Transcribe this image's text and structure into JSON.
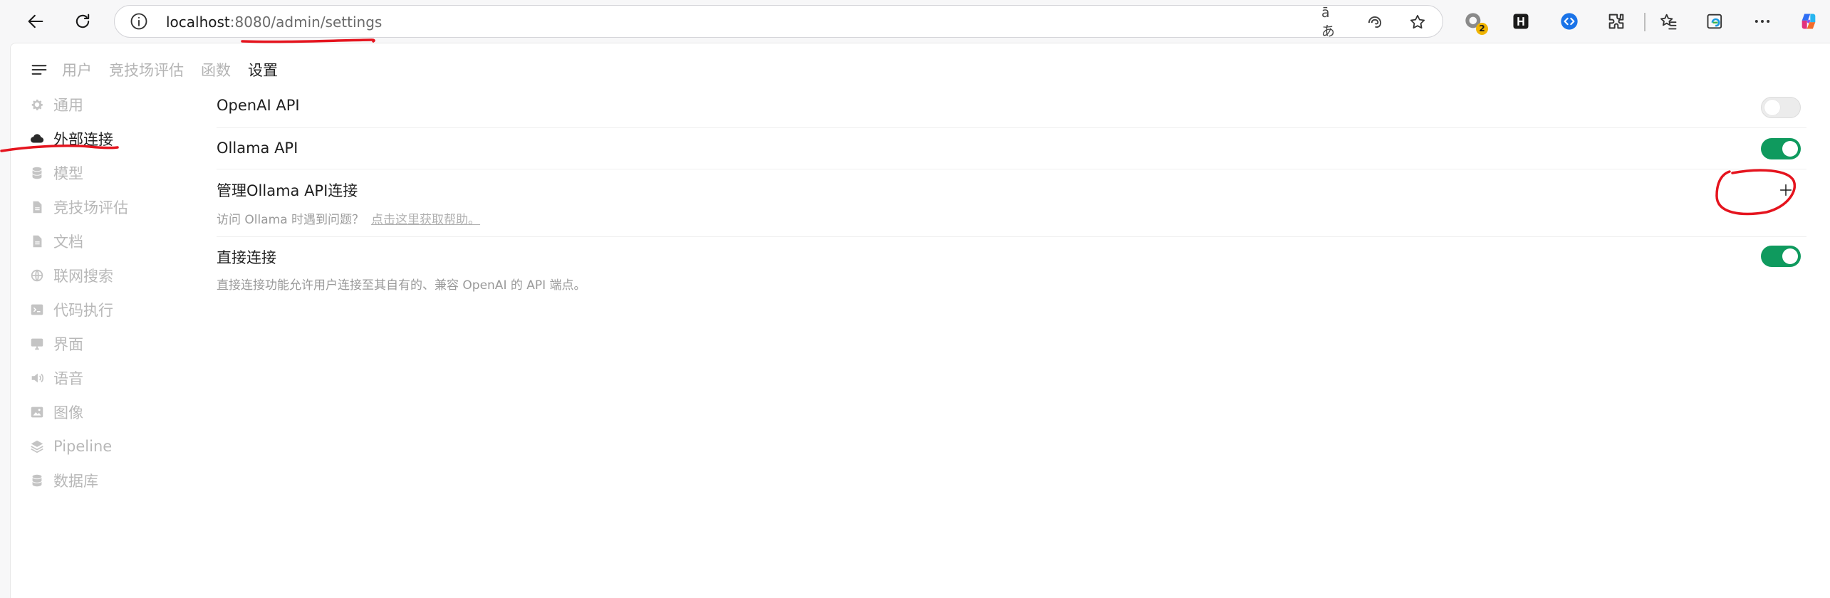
{
  "browser": {
    "url_host": "localhost",
    "url_rest": ":8080/admin/settings",
    "translate_glyph": "āあ",
    "extension_badge": "2",
    "toolbar_icons": [
      "back-arrow-icon",
      "refresh-icon",
      "info-icon",
      "translate-icon",
      "edge-bar-icon",
      "star-icon",
      "extensions-icon",
      "favorites-icon",
      "more-icon",
      "copilot-icon"
    ]
  },
  "topnav": {
    "tabs": [
      {
        "label": "用户"
      },
      {
        "label": "竞技场评估"
      },
      {
        "label": "函数"
      },
      {
        "label": "设置"
      }
    ]
  },
  "sidebar": {
    "items": [
      {
        "label": "通用",
        "icon": "gear-icon"
      },
      {
        "label": "外部连接",
        "icon": "cloud-icon"
      },
      {
        "label": "模型",
        "icon": "database-icon"
      },
      {
        "label": "竞技场评估",
        "icon": "document-icon"
      },
      {
        "label": "文档",
        "icon": "document-icon"
      },
      {
        "label": "联网搜索",
        "icon": "globe-icon"
      },
      {
        "label": "代码执行",
        "icon": "terminal-icon"
      },
      {
        "label": "界面",
        "icon": "monitor-icon"
      },
      {
        "label": "语音",
        "icon": "speaker-icon"
      },
      {
        "label": "图像",
        "icon": "image-icon"
      },
      {
        "label": "Pipeline",
        "icon": "layers-icon"
      },
      {
        "label": "数据库",
        "icon": "database-icon"
      }
    ]
  },
  "connections": {
    "openai": {
      "label": "OpenAI API",
      "enabled": false
    },
    "ollama": {
      "label": "Ollama API",
      "enabled": true
    },
    "manage": {
      "label": "管理Ollama API连接",
      "help_text": "访问 Ollama 时遇到问题？",
      "help_link": "点击这里获取帮助。"
    },
    "direct": {
      "label": "直接连接",
      "description": "直接连接功能允许用户连接至其自有的、兼容 OpenAI 的 API 端点。",
      "enabled": true
    }
  },
  "colors": {
    "toggle_on": "#0f9a5e",
    "toggle_off": "#ececec",
    "annotation": "#e5141e"
  }
}
